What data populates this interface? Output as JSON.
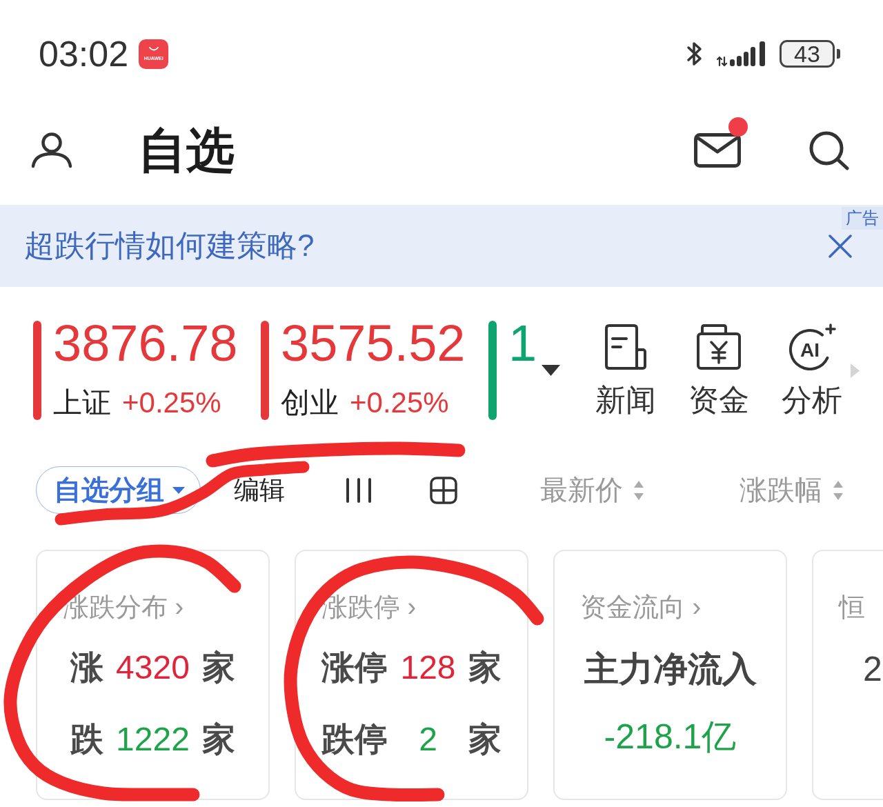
{
  "status_bar": {
    "time": "03:02",
    "app_icon_label": "HUAWEI",
    "battery": "43"
  },
  "header": {
    "title": "自选",
    "mail_unread": true
  },
  "ad_banner": {
    "text": "超跌行情如何建策略?",
    "tag": "广告"
  },
  "indices": [
    {
      "value": "3876.78",
      "name": "上证",
      "change": "+0.25%",
      "color": "#e5383b",
      "underlined": false
    },
    {
      "value": "3575.52",
      "name": "创业",
      "change": "+0.25%",
      "color": "#e5383b",
      "underlined": true
    },
    {
      "value": "1",
      "color": "#0ea46f",
      "underlined": false
    }
  ],
  "quick_actions": [
    {
      "kind": "news",
      "label": "新闻"
    },
    {
      "kind": "funds",
      "label": "资金"
    },
    {
      "kind": "ai",
      "label": "分析",
      "icon_text": "AI"
    }
  ],
  "toolbar": {
    "group": "自选分组",
    "edit": "编辑",
    "sort_columns": [
      "最新价",
      "涨跌幅"
    ],
    "struck_through": true
  },
  "cards": [
    {
      "kind": "counts",
      "title": "涨跌分布 ›",
      "circled": true,
      "rows": [
        {
          "label": "涨",
          "value": "4320",
          "unit": "家",
          "color": "#e0243a"
        },
        {
          "label": "跌",
          "value": "1222",
          "unit": "家",
          "color": "#1ea34a"
        }
      ]
    },
    {
      "kind": "counts",
      "title": "涨跌停 ›",
      "circled": true,
      "rows": [
        {
          "label": "涨停",
          "value": "128",
          "unit": "家",
          "color": "#e0243a"
        },
        {
          "label": "跌停",
          "value": "2",
          "unit": "家",
          "color": "#1ea34a"
        }
      ]
    },
    {
      "kind": "summary",
      "title": "资金流向 ›",
      "circled": false,
      "headline": "主力净流入",
      "value": "-218.1亿",
      "color": "#1ea34a"
    },
    {
      "kind": "quote",
      "title": "恒",
      "circled": false,
      "value": "2"
    }
  ]
}
